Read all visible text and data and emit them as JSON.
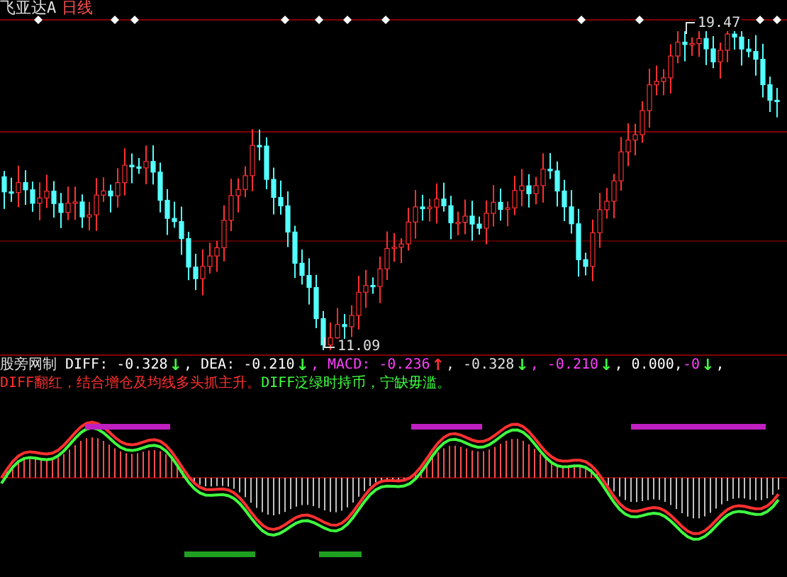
{
  "title": {
    "name": "飞亚达A",
    "period": "日线"
  },
  "price_chart": {
    "high_label": "19.47",
    "low_label": "11.09"
  },
  "indicator": {
    "name": "股旁网制",
    "values": [
      {
        "kind": "value",
        "text": "DIFF: -0.328",
        "color": "#ffffff"
      },
      {
        "kind": "arrow",
        "text": "↓",
        "color": "#40ff40"
      },
      {
        "kind": "value",
        "text": ", DEA: -0.210",
        "color": "#ffffff"
      },
      {
        "kind": "arrow",
        "text": "↓",
        "color": "#40ff40"
      },
      {
        "kind": "value",
        "text": ", MACD: -0.236",
        "color": "#ff40ff"
      },
      {
        "kind": "arrow",
        "text": "↑",
        "color": "#ff3030"
      },
      {
        "kind": "value",
        "text": ", -0.328",
        "color": "#e0e0e0"
      },
      {
        "kind": "arrow",
        "text": "↓",
        "color": "#40ff40"
      },
      {
        "kind": "value",
        "text": ", -0.210",
        "color": "#ff40ff"
      },
      {
        "kind": "arrow",
        "text": "↓",
        "color": "#40ff40"
      },
      {
        "kind": "value",
        "text": ", 0.000, ",
        "color": "#ffffff"
      },
      {
        "kind": "value",
        "text": "-0",
        "color": "#ff40ff"
      },
      {
        "kind": "arrow",
        "text": "↓",
        "color": "#40ff40"
      },
      {
        "kind": "value",
        "text": ",",
        "color": "#ffffff"
      }
    ]
  },
  "signal_text": [
    {
      "text": "DIFF翻红，结合增仓及均线多头抓主升。",
      "color": "#ff3030"
    },
    {
      "text": "DIFF泛绿时持币，宁缺毋滥。",
      "color": "#40ff40"
    }
  ]
}
